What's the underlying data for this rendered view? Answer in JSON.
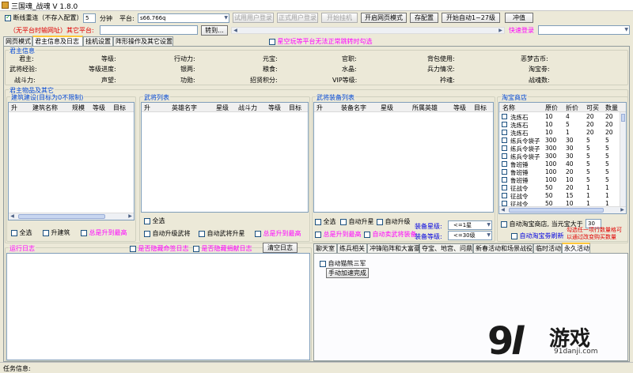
{
  "window": {
    "title": "三国魂_战魂 V 1.8.0"
  },
  "toolbar": {
    "reconnect_label": "断线重连（不存入配置）",
    "minutes_value": "5",
    "minutes_unit": "分钟",
    "platform_label": "平台:",
    "platform_value": "s66.766q",
    "try_login": "试用用户登录",
    "official_login": "正式用户登录",
    "start_hang": "开始挂机",
    "open_web_mode": "开启网页模式",
    "save_config": "存配置",
    "start_auto": "开始自动1~27级",
    "recharge": "冲值",
    "no_platform_note": "（无平台时输网址）其它平台:",
    "goto": "转到...",
    "quick_login": "快速登录"
  },
  "main_tabs": [
    "网页模式",
    "君主信息及日志",
    "挂机设置",
    "阵形操作及其它设置"
  ],
  "xingkong_note": "星空玩等平台无法正常跳转时勾选",
  "lord_info": {
    "title": "君主信息",
    "rows": [
      [
        "君主:",
        "等级:",
        "行动力:",
        "元宝:",
        "官职:",
        "背包使用:",
        "恶梦古币:"
      ],
      [
        "武将经验:",
        "等级进度:",
        "银两:",
        "粮食:",
        "水晶:",
        "兵力情况:",
        "淘宝劵:"
      ],
      [
        "战斗力:",
        "声望:",
        "功勋:",
        "招贤积分:",
        "VIP等级:",
        "衿魂:",
        "战魂数:"
      ]
    ]
  },
  "items_section": {
    "title": "君主物品及其它"
  },
  "building": {
    "title": "建筑建设(目标为0不限制)",
    "columns": [
      "升",
      "建筑名称",
      "规模",
      "等级",
      "目标"
    ],
    "select_all": "全选",
    "upgrade": "升建筑",
    "always_max": "总是升到最高"
  },
  "generals": {
    "title": "武将列表",
    "columns": [
      "升",
      "英雄名字",
      "星级",
      "战斗力",
      "等级",
      "目标"
    ],
    "select_all": "全选",
    "auto_upgrade": "自动升级武将",
    "auto_star": "自动武将升星",
    "always_max": "总是升到最高"
  },
  "equipment": {
    "title": "武将装备列表",
    "columns": [
      "升",
      "装备名字",
      "星级",
      "所属英雄",
      "等级",
      "目标"
    ],
    "select_all": "全选",
    "auto_star": "自动升星",
    "auto_level": "自动升级",
    "always_max": "总是升到最高",
    "auto_sell": "自动卖武将装备",
    "star_label": "装备星级:",
    "star_value": "<=1星",
    "level_label": "装备等级:",
    "level_value": "<=30级"
  },
  "shop": {
    "title": "淘宝商店",
    "columns": [
      "名称",
      "原价",
      "折价",
      "可买",
      "数量"
    ],
    "rows": [
      [
        "洗炼石",
        "10",
        "4",
        "20",
        "20"
      ],
      [
        "洗炼石",
        "10",
        "5",
        "20",
        "20"
      ],
      [
        "洗炼石",
        "10",
        "1",
        "20",
        "20"
      ],
      [
        "练兵令袋子",
        "300",
        "30",
        "5",
        "5"
      ],
      [
        "练兵令袋子",
        "300",
        "30",
        "5",
        "5"
      ],
      [
        "练兵令袋子",
        "300",
        "30",
        "5",
        "5"
      ],
      [
        "鲁班锤",
        "100",
        "40",
        "5",
        "5"
      ],
      [
        "鲁班锤",
        "100",
        "20",
        "5",
        "5"
      ],
      [
        "鲁班锤",
        "100",
        "10",
        "5",
        "5"
      ],
      [
        "征战令",
        "50",
        "20",
        "1",
        "1"
      ],
      [
        "征战令",
        "50",
        "15",
        "1",
        "1"
      ],
      [
        "征战令",
        "50",
        "10",
        "1",
        "1"
      ]
    ],
    "auto_shop": "自动淘宝商店, 当元宝大于",
    "threshold": "30",
    "auto_refresh": "自动淘宝劵刷新",
    "note_line1": "勾选任一项行数量格可",
    "note_line2": "以通过改变购买数量"
  },
  "log": {
    "title": "运行日志",
    "hide_sign": "是否隐藏命签日志",
    "hide_donate": "是否隐藏捐献日志",
    "clear": "清空日志"
  },
  "bottom_tabs": [
    "聊天室",
    "练兵相关",
    "冲锋陷阵和大富豪",
    "夺宝、地宫、问鼎",
    "新春活动和场景战役",
    "临时活动",
    "永久活动"
  ],
  "permanent": {
    "auto_bear": "自动猫熊三军",
    "manual_speed": "手动加速完成"
  },
  "status": {
    "label": "任务信息:"
  },
  "watermark": {
    "brand": "游戏",
    "url": "91danji.com"
  },
  "colors": {
    "accent": "#0046d5",
    "red": "#e00000",
    "pink": "#ff00ff"
  }
}
